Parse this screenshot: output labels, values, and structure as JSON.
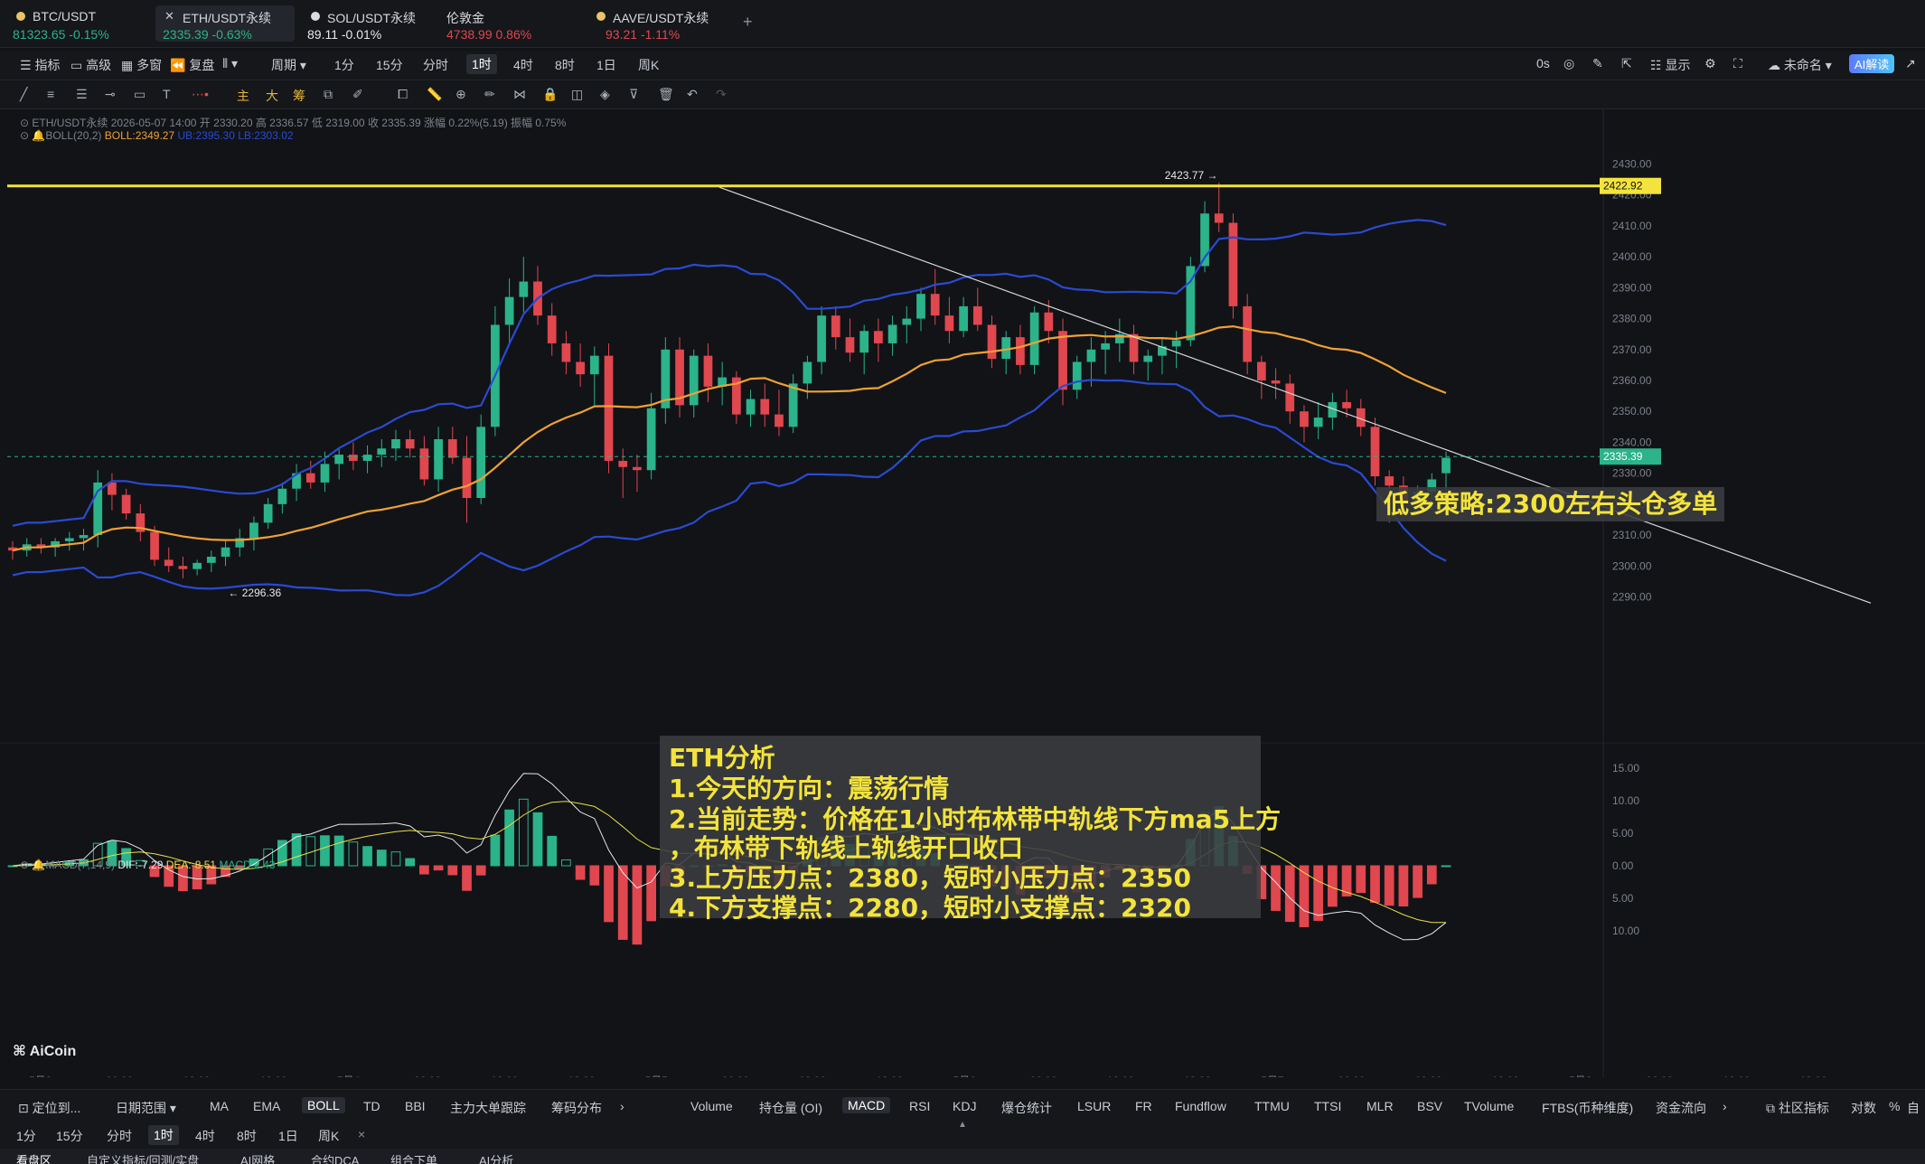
{
  "tabs": [
    {
      "name": "BTC/USDT",
      "price": "81323.65",
      "chg": "-0.15%",
      "color": "green"
    },
    {
      "name": "ETH/USDT永续",
      "price": "2335.39",
      "chg": "-0.63%",
      "color": "green"
    },
    {
      "name": "SOL/USDT永续",
      "price": "89.11",
      "chg": "-0.01%",
      "color": "plain"
    },
    {
      "name": "伦敦金",
      "price": "4738.99",
      "chg": "0.86%",
      "color": "red"
    },
    {
      "name": "AAVE/USDT永续",
      "price": "93.21",
      "chg": "-1.11%",
      "color": "red"
    }
  ],
  "tab_add": "+",
  "toolbar": {
    "indicator": "指标",
    "advanced": "高级",
    "multi": "多窗",
    "replay": "复盘",
    "period": "周期",
    "intervals": [
      "1分",
      "15分",
      "分时",
      "1时",
      "4时",
      "8时",
      "1日",
      "周K"
    ],
    "active_interval": "1时",
    "right": {
      "timer": "0s",
      "show": "显示",
      "unnamed": "未命名",
      "ai": "AI解读"
    }
  },
  "legend": {
    "line1": "ETH/USDT永续 2026-05-07 14:00 开 2330.20 高 2336.57 低 2319.00 收 2335.39 涨幅 0.22%(5.19) 振幅 0.75%",
    "line2a": "BOLL(20,2)",
    "line2b": "BOLL:2349.27",
    "line2c": "UB:2395.30 LB:2303.02",
    "macd_a": "MACD(7,14,9)",
    "macd_b": "DIF:-7.29",
    "macd_c": "DEA:-8.51",
    "macd_d": "MACD:2.43"
  },
  "annotations": {
    "high_label": "2423.77 →",
    "low_label": "← 2296.36",
    "yellow_line_price": "2422.92",
    "current_price": "2335.39",
    "strategy": "低多策略:2300左右头仓多单",
    "analysis": [
      "ETH分析",
      "1.今天的方向：震荡行情",
      "2.当前走势：价格在1小时布林带中轨线下方ma5上方",
      "，布林带下轨线上轨线开口收口",
      "3.上方压力点：2380，短时小压力点：2350",
      "4.下方支撑点：2280，短时小支撑点：2320"
    ]
  },
  "chart_data": {
    "type": "candlestick",
    "symbol": "ETH/USDT永续",
    "price_axis": [
      "2430.00",
      "2420.00",
      "2410.00",
      "2400.00",
      "2390.00",
      "2380.00",
      "2370.00",
      "2360.00",
      "2350.00",
      "2340.00",
      "2330.00",
      "2320.00",
      "2310.00",
      "2300.00",
      "2290.00"
    ],
    "price_range": [
      2284,
      2436
    ],
    "macd_axis": [
      "15.00",
      "10.00",
      "5.00",
      "0.00",
      "-5.00",
      "-10.00"
    ],
    "time_axis": [
      "5月3",
      "06:00",
      "12:00",
      "18:00",
      "5月4",
      "06:00",
      "12:00",
      "18:00",
      "5月5",
      "06:00",
      "12:00",
      "18:00",
      "5月6",
      "06:00",
      "12:00",
      "18:00",
      "5月7",
      "06:00",
      "12:00",
      "18:00",
      "5月8",
      "06:00",
      "12:00",
      "18:00"
    ],
    "candles": [
      [
        2306,
        2308,
        2302,
        2305
      ],
      [
        2305,
        2309,
        2303,
        2307
      ],
      [
        2307,
        2309,
        2304,
        2306
      ],
      [
        2306,
        2309,
        2303,
        2308
      ],
      [
        2308,
        2311,
        2305,
        2309
      ],
      [
        2309,
        2312,
        2305,
        2310
      ],
      [
        2310,
        2331,
        2306,
        2327
      ],
      [
        2327,
        2330,
        2318,
        2323
      ],
      [
        2323,
        2325,
        2315,
        2317
      ],
      [
        2317,
        2320,
        2308,
        2311
      ],
      [
        2311,
        2313,
        2300,
        2302
      ],
      [
        2302,
        2306,
        2298,
        2300
      ],
      [
        2300,
        2303,
        2296,
        2299
      ],
      [
        2299,
        2302,
        2297,
        2301
      ],
      [
        2301,
        2305,
        2298,
        2303
      ],
      [
        2303,
        2308,
        2300,
        2306
      ],
      [
        2306,
        2312,
        2303,
        2309
      ],
      [
        2309,
        2316,
        2305,
        2314
      ],
      [
        2314,
        2322,
        2312,
        2320
      ],
      [
        2320,
        2327,
        2317,
        2325
      ],
      [
        2325,
        2333,
        2321,
        2330
      ],
      [
        2330,
        2334,
        2325,
        2327
      ],
      [
        2327,
        2337,
        2324,
        2333
      ],
      [
        2333,
        2338,
        2328,
        2336
      ],
      [
        2336,
        2340,
        2331,
        2334
      ],
      [
        2334,
        2339,
        2330,
        2336
      ],
      [
        2336,
        2341,
        2332,
        2338
      ],
      [
        2338,
        2344,
        2334,
        2341
      ],
      [
        2341,
        2344,
        2335,
        2338
      ],
      [
        2338,
        2342,
        2326,
        2328
      ],
      [
        2328,
        2345,
        2324,
        2341
      ],
      [
        2341,
        2345,
        2333,
        2335
      ],
      [
        2335,
        2342,
        2314,
        2322
      ],
      [
        2322,
        2349,
        2320,
        2345
      ],
      [
        2345,
        2384,
        2342,
        2378
      ],
      [
        2378,
        2393,
        2372,
        2387
      ],
      [
        2387,
        2400,
        2382,
        2392
      ],
      [
        2392,
        2397,
        2378,
        2381
      ],
      [
        2381,
        2385,
        2368,
        2372
      ],
      [
        2372,
        2376,
        2362,
        2366
      ],
      [
        2366,
        2372,
        2358,
        2362
      ],
      [
        2362,
        2371,
        2352,
        2368
      ],
      [
        2368,
        2372,
        2330,
        2334
      ],
      [
        2334,
        2338,
        2322,
        2332
      ],
      [
        2332,
        2336,
        2324,
        2331
      ],
      [
        2331,
        2356,
        2328,
        2351
      ],
      [
        2351,
        2374,
        2346,
        2370
      ],
      [
        2370,
        2374,
        2348,
        2352
      ],
      [
        2352,
        2370,
        2348,
        2368
      ],
      [
        2368,
        2372,
        2353,
        2358
      ],
      [
        2358,
        2366,
        2352,
        2361
      ],
      [
        2361,
        2363,
        2346,
        2349
      ],
      [
        2349,
        2357,
        2345,
        2354
      ],
      [
        2354,
        2359,
        2345,
        2349
      ],
      [
        2349,
        2357,
        2342,
        2345
      ],
      [
        2345,
        2362,
        2343,
        2359
      ],
      [
        2359,
        2368,
        2354,
        2366
      ],
      [
        2366,
        2384,
        2362,
        2381
      ],
      [
        2381,
        2384,
        2370,
        2374
      ],
      [
        2374,
        2380,
        2366,
        2369
      ],
      [
        2369,
        2378,
        2362,
        2376
      ],
      [
        2376,
        2380,
        2366,
        2372
      ],
      [
        2372,
        2381,
        2368,
        2378
      ],
      [
        2378,
        2384,
        2372,
        2380
      ],
      [
        2380,
        2390,
        2376,
        2388
      ],
      [
        2388,
        2396,
        2378,
        2381
      ],
      [
        2381,
        2387,
        2372,
        2376
      ],
      [
        2376,
        2387,
        2374,
        2384
      ],
      [
        2384,
        2390,
        2376,
        2378
      ],
      [
        2378,
        2381,
        2364,
        2367
      ],
      [
        2367,
        2376,
        2362,
        2374
      ],
      [
        2374,
        2378,
        2362,
        2365
      ],
      [
        2365,
        2384,
        2362,
        2382
      ],
      [
        2382,
        2386,
        2372,
        2376
      ],
      [
        2376,
        2380,
        2352,
        2357
      ],
      [
        2357,
        2368,
        2354,
        2366
      ],
      [
        2366,
        2374,
        2358,
        2370
      ],
      [
        2370,
        2376,
        2362,
        2372
      ],
      [
        2372,
        2380,
        2366,
        2375
      ],
      [
        2375,
        2378,
        2362,
        2366
      ],
      [
        2366,
        2370,
        2360,
        2368
      ],
      [
        2368,
        2374,
        2362,
        2371
      ],
      [
        2371,
        2376,
        2364,
        2373
      ],
      [
        2373,
        2400,
        2371,
        2397
      ],
      [
        2397,
        2418,
        2395,
        2414
      ],
      [
        2414,
        2424,
        2408,
        2411
      ],
      [
        2411,
        2414,
        2380,
        2384
      ],
      [
        2384,
        2388,
        2362,
        2366
      ],
      [
        2366,
        2368,
        2354,
        2360
      ],
      [
        2360,
        2364,
        2354,
        2359
      ],
      [
        2359,
        2362,
        2346,
        2350
      ],
      [
        2350,
        2352,
        2340,
        2345
      ],
      [
        2345,
        2353,
        2341,
        2348
      ],
      [
        2348,
        2356,
        2344,
        2353
      ],
      [
        2353,
        2357,
        2348,
        2351
      ],
      [
        2351,
        2354,
        2342,
        2345
      ],
      [
        2345,
        2348,
        2326,
        2329
      ],
      [
        2329,
        2331,
        2314,
        2326
      ],
      [
        2326,
        2329,
        2318,
        2321
      ],
      [
        2321,
        2326,
        2316,
        2324
      ],
      [
        2324,
        2330,
        2318,
        2328
      ],
      [
        2330,
        2337,
        2319,
        2335
      ]
    ],
    "bollinger_mid_samples": [
      2300,
      2310,
      2318,
      2330,
      2345,
      2350,
      2355,
      2360,
      2362,
      2365,
      2372,
      2378,
      2377,
      2373,
      2368,
      2366,
      2362,
      2358,
      2350
    ],
    "yellow_hline": 2422.92,
    "trendline": {
      "from": [
        2422,
        "5月5 03:00"
      ],
      "to": [
        2290,
        "5月8 12:00"
      ]
    }
  },
  "bottom": {
    "locate": "定位到...",
    "daterange": "日期范围",
    "indicators": [
      "MA",
      "EMA",
      "BOLL",
      "TD",
      "BBI",
      "主力大单跟踪",
      "筹码分布"
    ],
    "active_indicator": "BOLL",
    "sub_indicators": [
      "Volume",
      "持仓量 (OI)",
      "MACD",
      "RSI",
      "KDJ",
      "爆仓统计",
      "LSUR",
      "FR",
      "Fundflow",
      "TTMU",
      "TTSI",
      "MLR",
      "BSV",
      "TVolume",
      "FTBS(币种维度)",
      "资金流向"
    ],
    "active_sub": "MACD",
    "community": "社区指标",
    "pair": "对数",
    "pct": "%",
    "auto": "自",
    "intervals": [
      "1分",
      "15分",
      "分时",
      "1时",
      "4时",
      "8时",
      "1日",
      "周K"
    ],
    "active_interval": "1时",
    "close": "×",
    "tabs": [
      "看盘区",
      "自定义指标/回测/实盘",
      "AI网格",
      "合约DCA",
      "组合下单",
      "AI分析"
    ],
    "brand": "AiCoin"
  }
}
